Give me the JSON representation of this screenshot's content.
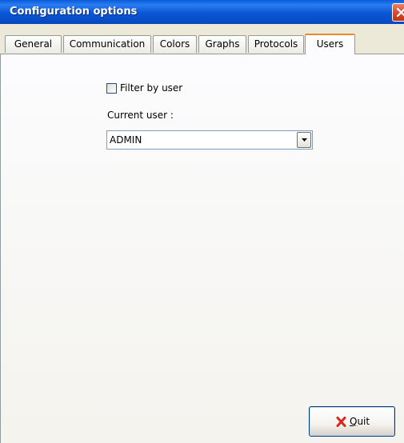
{
  "window": {
    "title": "Configuration options",
    "titlebar_color": "#0a56d4",
    "close_icon": "close-icon"
  },
  "tabs": [
    {
      "label": "General",
      "active": false
    },
    {
      "label": "Communication",
      "active": false
    },
    {
      "label": "Colors",
      "active": false
    },
    {
      "label": "Graphs",
      "active": false
    },
    {
      "label": "Protocols",
      "active": false
    },
    {
      "label": "Users",
      "active": true
    }
  ],
  "users_panel": {
    "filter_by_user": {
      "label": "Filter by user",
      "checked": false
    },
    "current_user_label": "Current user :",
    "current_user_value": "ADMIN",
    "dropdown_icon": "chevron-down-icon"
  },
  "footer": {
    "quit_mnemonic": "Q",
    "quit_rest": "uit",
    "quit_icon": "red-x-icon",
    "quit_icon_color": "#d8281a"
  }
}
